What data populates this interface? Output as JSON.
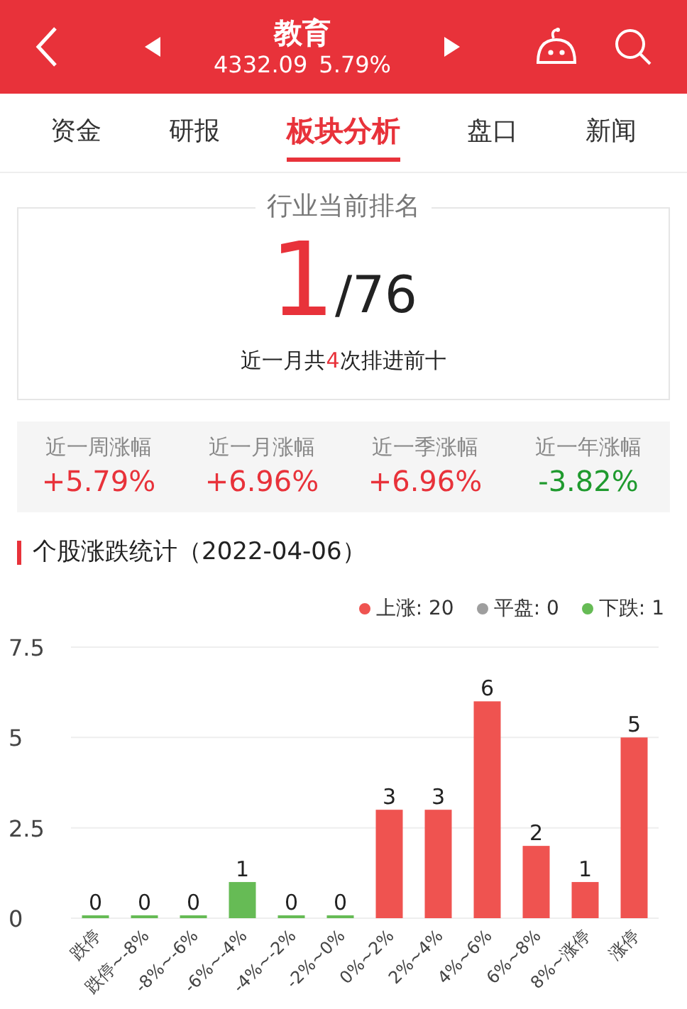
{
  "header": {
    "title": "教育",
    "price": "4332.09",
    "change": "5.79%"
  },
  "tabs": [
    {
      "label": "资金",
      "selected": false
    },
    {
      "label": "研报",
      "selected": false
    },
    {
      "label": "板块分析",
      "selected": true
    },
    {
      "label": "盘口",
      "selected": false
    },
    {
      "label": "新闻",
      "selected": false
    }
  ],
  "ranking": {
    "title": "行业当前排名",
    "rank": "1",
    "total": "/76",
    "note": {
      "before": "近一月共",
      "count": "4",
      "after": "次排进前十"
    }
  },
  "performance": [
    {
      "label": "近一周涨幅",
      "value": "+5.79%",
      "color": "#e8323a"
    },
    {
      "label": "近一月涨幅",
      "value": "+6.96%",
      "color": "#e8323a"
    },
    {
      "label": "近一季涨幅",
      "value": "+6.96%",
      "color": "#e8323a"
    },
    {
      "label": "近一年涨幅",
      "value": "-3.82%",
      "color": "#1f9a2e"
    }
  ],
  "section_title": "个股涨跌统计（2022-04-06）",
  "legend": [
    {
      "label": "上涨: 20",
      "color": "#ef5350"
    },
    {
      "label": "平盘: 0",
      "color": "#9e9e9e"
    },
    {
      "label": "下跌: 1",
      "color": "#66bb55"
    }
  ],
  "chart_data": {
    "type": "bar",
    "categories": [
      "跌停",
      "跌停~-8%",
      "-8%~-6%",
      "-6%~-4%",
      "-4%~-2%",
      "-2%~0%",
      "0%~2%",
      "2%~4%",
      "4%~6%",
      "6%~8%",
      "8%~涨停",
      "涨停"
    ],
    "series": [
      {
        "color": "#66bb55",
        "values": [
          0,
          0,
          0,
          1,
          0,
          0,
          null,
          null,
          null,
          null,
          null,
          null
        ]
      },
      {
        "color": "#ef5350",
        "values": [
          null,
          null,
          null,
          null,
          null,
          null,
          3,
          3,
          6,
          2,
          1,
          5
        ]
      }
    ],
    "ylim": [
      0,
      7.5
    ],
    "yticks": [
      {
        "value": 0,
        "label": "0"
      },
      {
        "value": 2.5,
        "label": "2.5"
      },
      {
        "value": 5,
        "label": "5"
      },
      {
        "value": 7.5,
        "label": "7.5"
      }
    ],
    "data_labels": true
  }
}
